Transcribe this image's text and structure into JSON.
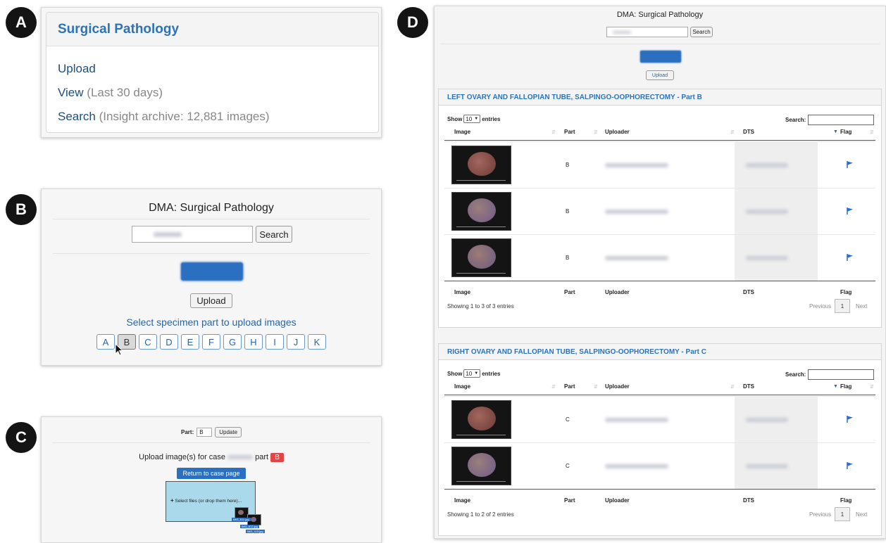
{
  "badges": [
    "A",
    "B",
    "C",
    "D"
  ],
  "panelA": {
    "title": "Surgical Pathology",
    "upload": "Upload",
    "view": "View",
    "view_note": "(Last 30 days)",
    "search": "Search",
    "search_note": "(Insight archive: 12,881 images)"
  },
  "panelB": {
    "title": "DMA: Surgical Pathology",
    "search_button": "Search",
    "upload_button": "Upload",
    "select_text": "Select specimen part to upload images",
    "parts": [
      "A",
      "B",
      "C",
      "D",
      "E",
      "F",
      "G",
      "H",
      "I",
      "J",
      "K"
    ],
    "active_part": "B"
  },
  "panelC": {
    "part_label": "Part:",
    "part_value": "B",
    "update_button": "Update",
    "upload_prefix": "Upload image(s) for case",
    "upload_mid": "part",
    "part_badge": "B",
    "return_button": "Return to case page",
    "drop_text": "Select files (or drop them here)...",
    "file_labels": [
      "IMG_611.jpg",
      "IMG_612.jpg",
      "IMG_113.jpg"
    ]
  },
  "panelD": {
    "title": "DMA: Surgical Pathology",
    "search_button": "Search",
    "upload_button": "Upload",
    "show_label": "Show",
    "entries_value": "10",
    "entries_label": "entries",
    "search_label": "Search:",
    "columns": [
      "Image",
      "Part",
      "Uploader",
      "DTS",
      "Flag"
    ],
    "prev": "Previous",
    "page": "1",
    "next": "Next",
    "sections": [
      {
        "title": "LEFT OVARY AND FALLOPIAN TUBE, SALPINGO-OOPHORECTOMY - Part B",
        "rows": [
          {
            "part": "B"
          },
          {
            "part": "B"
          },
          {
            "part": "B"
          }
        ],
        "showing": "Showing 1 to 3 of 3 entries"
      },
      {
        "title": "RIGHT OVARY AND FALLOPIAN TUBE, SALPINGO-OOPHORECTOMY - Part C",
        "rows": [
          {
            "part": "C"
          },
          {
            "part": "C"
          }
        ],
        "showing": "Showing 1 to 2 of 2 entries"
      }
    ]
  },
  "colors": {
    "link_blue": "#2a74bd",
    "button_blue": "#2b6fc0",
    "badge_red": "#e04646",
    "drop_zone": "#a9d9ea",
    "flag_blue": "#2a6fc9"
  }
}
